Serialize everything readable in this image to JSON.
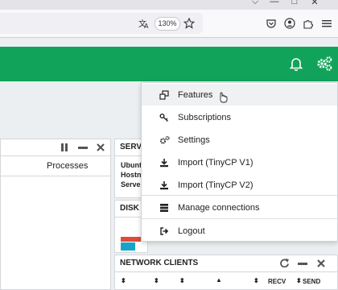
{
  "browser": {
    "zoom": "130%",
    "window_buttons": [
      "⌵",
      "—",
      "□",
      "✕"
    ]
  },
  "widgets": {
    "left_column_header": "Processes",
    "server_title": "SERVER",
    "server_lines": [
      "Ubuntu",
      "Hostname",
      "Server"
    ],
    "disk_title": "DISK",
    "network_title": "NETWORK CLIENTS",
    "network_columns": [
      "RECV",
      "SEND"
    ]
  },
  "menu": {
    "items": [
      {
        "label": "Features",
        "icon": "features-icon"
      },
      {
        "label": "Subscriptions",
        "icon": "key-icon"
      },
      {
        "label": "Settings",
        "icon": "gears-icon"
      },
      {
        "label": "Import (TinyCP V1)",
        "icon": "download-icon"
      },
      {
        "label": "Import (TinyCP V2)",
        "icon": "download-icon"
      },
      {
        "label": "Manage connections",
        "icon": "server-icon"
      },
      {
        "label": "Logout",
        "icon": "logout-icon"
      }
    ]
  },
  "colors": {
    "appbar": "#11a35a",
    "disk_bar_red": "#e04b3c",
    "disk_bar_teal": "#18a4c8"
  }
}
